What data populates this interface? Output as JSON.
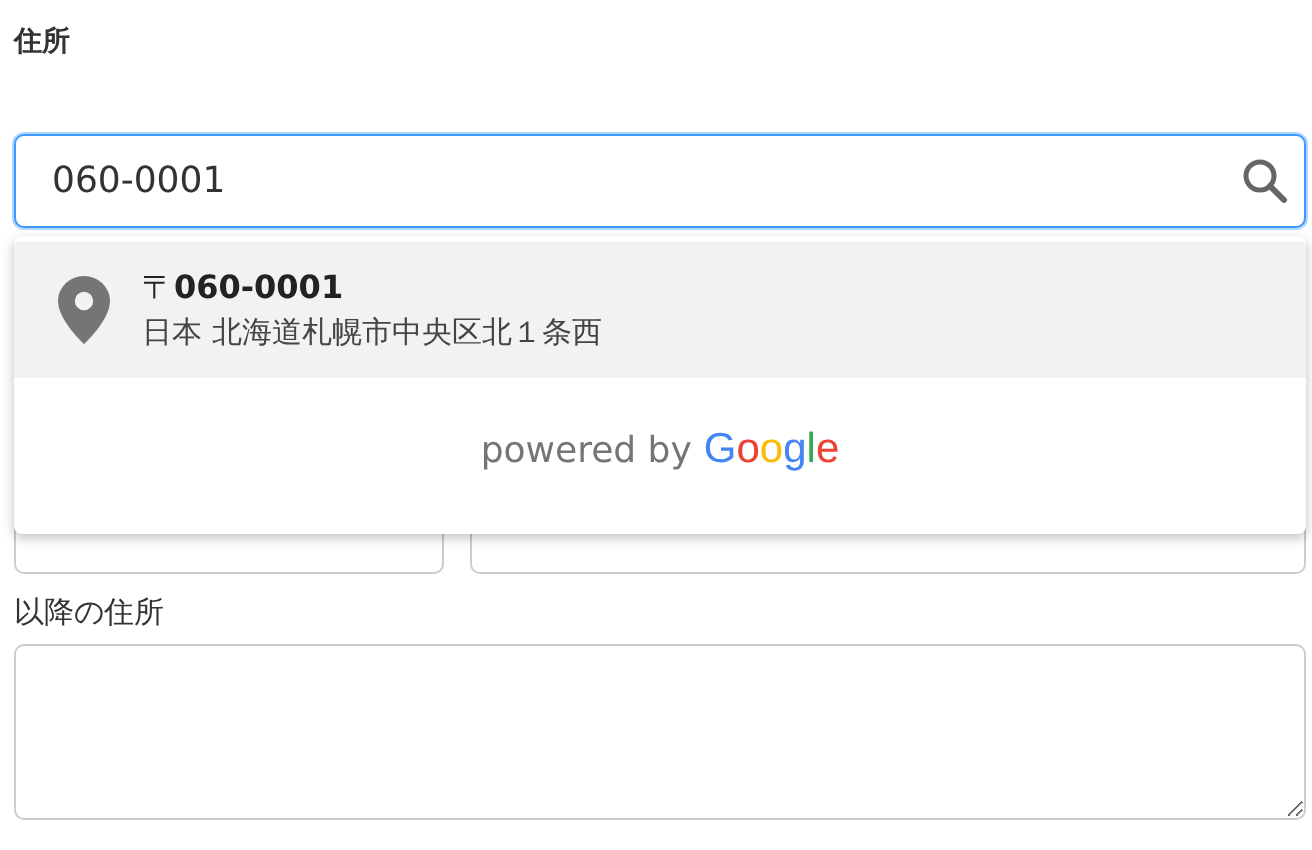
{
  "address_label": "住所",
  "search_field": {
    "value": "060-0001"
  },
  "suggestions": [
    {
      "title": "〒**060-0001**",
      "subtitle": "日本 北海道札幌市中央区北１条西",
      "selected": true
    }
  ],
  "attribution": {
    "text": "powered by",
    "logo": "Google"
  },
  "additional_label": "以降の住所"
}
